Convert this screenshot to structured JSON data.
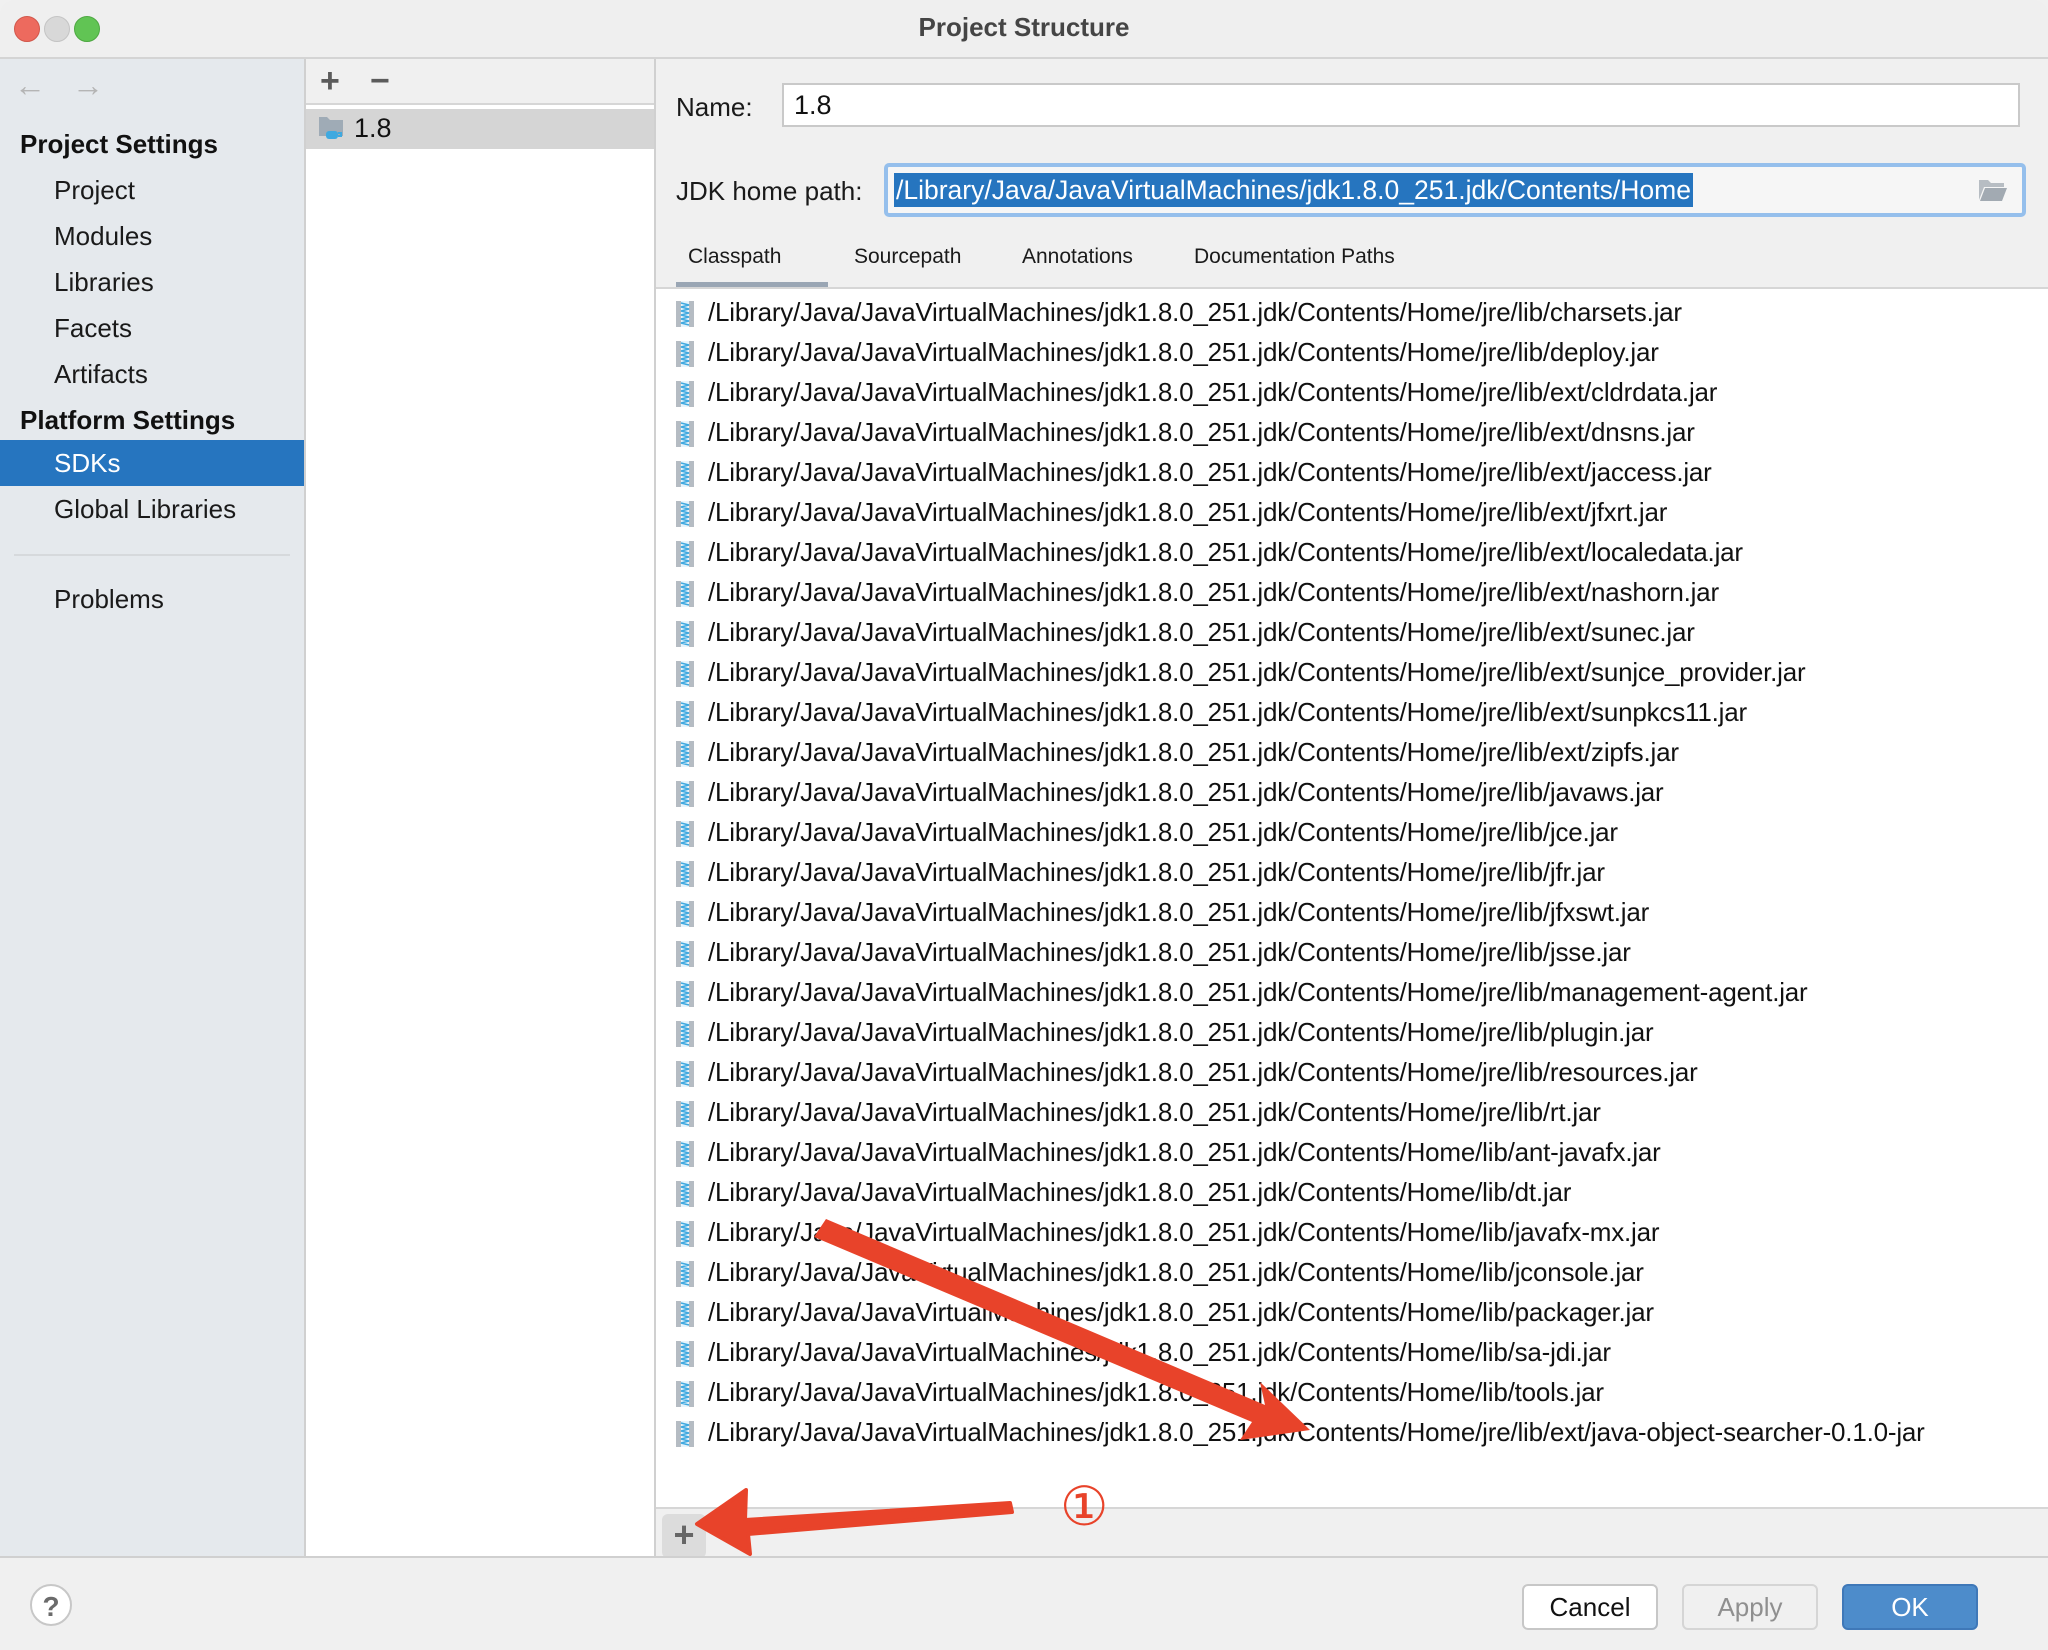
{
  "window": {
    "title": "Project Structure"
  },
  "sidebar": {
    "back_icon": "←",
    "forward_icon": "→",
    "sections": [
      {
        "heading": "Project Settings",
        "items": [
          "Project",
          "Modules",
          "Libraries",
          "Facets",
          "Artifacts"
        ]
      },
      {
        "heading": "Platform Settings",
        "items": [
          "SDKs",
          "Global Libraries"
        ]
      }
    ],
    "selected_item": "SDKs",
    "problems_label": "Problems"
  },
  "sdk_list": {
    "add_icon": "+",
    "remove_icon": "−",
    "items": [
      {
        "label": "1.8",
        "icon": "jdk-folder-icon"
      }
    ]
  },
  "sdk_detail": {
    "name_label": "Name:",
    "name_value": "1.8",
    "jdk_home_label": "JDK home path:",
    "jdk_home_value": "/Library/Java/JavaVirtualMachines/jdk1.8.0_251.jdk/Contents/Home",
    "tabs": [
      "Classpath",
      "Sourcepath",
      "Annotations",
      "Documentation Paths"
    ],
    "active_tab": "Classpath",
    "classpath_entries": [
      "/Library/Java/JavaVirtualMachines/jdk1.8.0_251.jdk/Contents/Home/jre/lib/charsets.jar",
      "/Library/Java/JavaVirtualMachines/jdk1.8.0_251.jdk/Contents/Home/jre/lib/deploy.jar",
      "/Library/Java/JavaVirtualMachines/jdk1.8.0_251.jdk/Contents/Home/jre/lib/ext/cldrdata.jar",
      "/Library/Java/JavaVirtualMachines/jdk1.8.0_251.jdk/Contents/Home/jre/lib/ext/dnsns.jar",
      "/Library/Java/JavaVirtualMachines/jdk1.8.0_251.jdk/Contents/Home/jre/lib/ext/jaccess.jar",
      "/Library/Java/JavaVirtualMachines/jdk1.8.0_251.jdk/Contents/Home/jre/lib/ext/jfxrt.jar",
      "/Library/Java/JavaVirtualMachines/jdk1.8.0_251.jdk/Contents/Home/jre/lib/ext/localedata.jar",
      "/Library/Java/JavaVirtualMachines/jdk1.8.0_251.jdk/Contents/Home/jre/lib/ext/nashorn.jar",
      "/Library/Java/JavaVirtualMachines/jdk1.8.0_251.jdk/Contents/Home/jre/lib/ext/sunec.jar",
      "/Library/Java/JavaVirtualMachines/jdk1.8.0_251.jdk/Contents/Home/jre/lib/ext/sunjce_provider.jar",
      "/Library/Java/JavaVirtualMachines/jdk1.8.0_251.jdk/Contents/Home/jre/lib/ext/sunpkcs11.jar",
      "/Library/Java/JavaVirtualMachines/jdk1.8.0_251.jdk/Contents/Home/jre/lib/ext/zipfs.jar",
      "/Library/Java/JavaVirtualMachines/jdk1.8.0_251.jdk/Contents/Home/jre/lib/javaws.jar",
      "/Library/Java/JavaVirtualMachines/jdk1.8.0_251.jdk/Contents/Home/jre/lib/jce.jar",
      "/Library/Java/JavaVirtualMachines/jdk1.8.0_251.jdk/Contents/Home/jre/lib/jfr.jar",
      "/Library/Java/JavaVirtualMachines/jdk1.8.0_251.jdk/Contents/Home/jre/lib/jfxswt.jar",
      "/Library/Java/JavaVirtualMachines/jdk1.8.0_251.jdk/Contents/Home/jre/lib/jsse.jar",
      "/Library/Java/JavaVirtualMachines/jdk1.8.0_251.jdk/Contents/Home/jre/lib/management-agent.jar",
      "/Library/Java/JavaVirtualMachines/jdk1.8.0_251.jdk/Contents/Home/jre/lib/plugin.jar",
      "/Library/Java/JavaVirtualMachines/jdk1.8.0_251.jdk/Contents/Home/jre/lib/resources.jar",
      "/Library/Java/JavaVirtualMachines/jdk1.8.0_251.jdk/Contents/Home/jre/lib/rt.jar",
      "/Library/Java/JavaVirtualMachines/jdk1.8.0_251.jdk/Contents/Home/lib/ant-javafx.jar",
      "/Library/Java/JavaVirtualMachines/jdk1.8.0_251.jdk/Contents/Home/lib/dt.jar",
      "/Library/Java/JavaVirtualMachines/jdk1.8.0_251.jdk/Contents/Home/lib/javafx-mx.jar",
      "/Library/Java/JavaVirtualMachines/jdk1.8.0_251.jdk/Contents/Home/lib/jconsole.jar",
      "/Library/Java/JavaVirtualMachines/jdk1.8.0_251.jdk/Contents/Home/lib/packager.jar",
      "/Library/Java/JavaVirtualMachines/jdk1.8.0_251.jdk/Contents/Home/lib/sa-jdi.jar",
      "/Library/Java/JavaVirtualMachines/jdk1.8.0_251.jdk/Contents/Home/lib/tools.jar",
      "/Library/Java/JavaVirtualMachines/jdk1.8.0_251.jdk/Contents/Home/jre/lib/ext/java-object-searcher-0.1.0-jar"
    ],
    "add_entry_icon": "+"
  },
  "footer": {
    "help_icon": "?",
    "cancel_label": "Cancel",
    "apply_label": "Apply",
    "ok_label": "OK"
  },
  "annotation": {
    "step_marker": "①",
    "color": "#e8432a"
  },
  "colors": {
    "selection": "#2675bf",
    "ok_button": "#4d8ccb",
    "focus_ring": "#95bfec"
  }
}
